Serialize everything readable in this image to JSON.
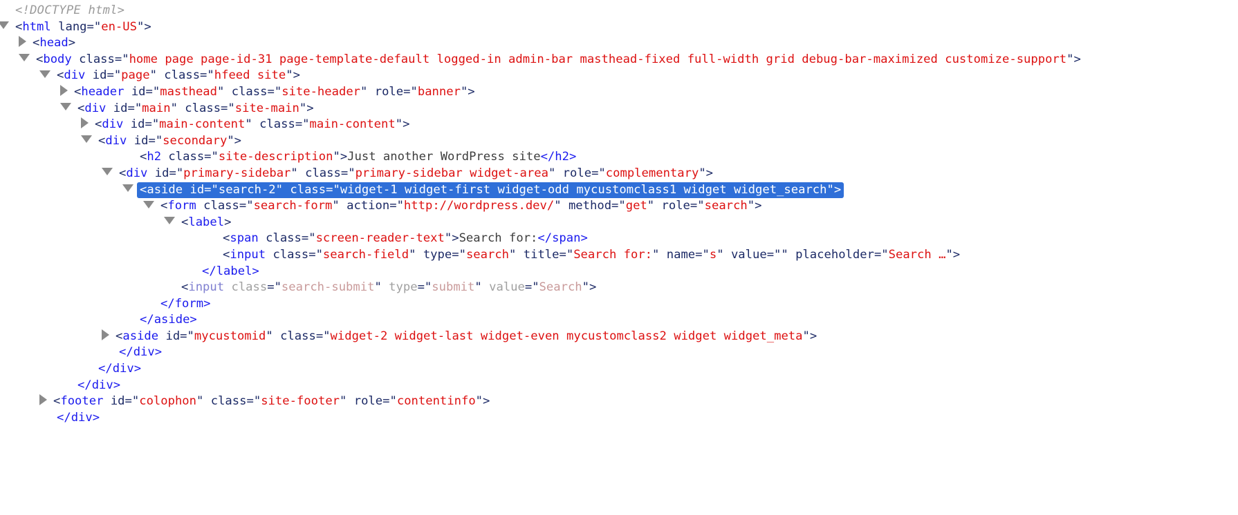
{
  "inspector": {
    "title": "DOM tree inspector",
    "selected_node_id": "search-2",
    "colors": {
      "tag": "#1a1aee",
      "attribute_name": "#1c2a66",
      "attribute_value": "#dd1111",
      "text_content": "#3d3d3d",
      "doctype": "#9a9a9a",
      "dimmed": "#a8a8a8",
      "selection_background": "#2f6fd8",
      "selection_text": "#ffffff",
      "twisty": "#8a8a8a",
      "background": "#ffffff"
    }
  },
  "rows": [
    {
      "depth": 1,
      "twisty": "none",
      "kind": "doctype",
      "text": "<!DOCTYPE html>"
    },
    {
      "depth": 0,
      "twisty": "open",
      "kind": "element",
      "open": "<",
      "tag": "html",
      "attrs": [
        {
          "name": "lang",
          "value": "en-US"
        }
      ],
      "close": ">"
    },
    {
      "depth": 2,
      "twisty": "closed",
      "kind": "element",
      "open": "<",
      "tag": "head",
      "attrs": [],
      "close": ">"
    },
    {
      "depth": 2,
      "twisty": "open",
      "kind": "element",
      "open": "<",
      "tag": "body",
      "attrs": [
        {
          "name": "class",
          "value": "home page page-id-31 page-template-default logged-in admin-bar masthead-fixed full-width grid debug-bar-maximized customize-support"
        }
      ],
      "close": ">"
    },
    {
      "depth": 4,
      "twisty": "open",
      "kind": "element",
      "open": "<",
      "tag": "div",
      "attrs": [
        {
          "name": "id",
          "value": "page"
        },
        {
          "name": "class",
          "value": "hfeed site"
        }
      ],
      "close": ">"
    },
    {
      "depth": 5,
      "twisty": "closed",
      "kind": "element",
      "open": "<",
      "tag": "header",
      "attrs": [
        {
          "name": "id",
          "value": "masthead"
        },
        {
          "name": "class",
          "value": "site-header"
        },
        {
          "name": "role",
          "value": "banner"
        }
      ],
      "close": ">"
    },
    {
      "depth": 5,
      "twisty": "open",
      "kind": "element",
      "open": "<",
      "tag": "div",
      "attrs": [
        {
          "name": "id",
          "value": "main"
        },
        {
          "name": "class",
          "value": "site-main"
        }
      ],
      "close": ">"
    },
    {
      "depth": 6,
      "twisty": "closed",
      "kind": "element",
      "open": "<",
      "tag": "div",
      "attrs": [
        {
          "name": "id",
          "value": "main-content"
        },
        {
          "name": "class",
          "value": "main-content"
        }
      ],
      "close": ">"
    },
    {
      "depth": 6,
      "twisty": "open",
      "kind": "element",
      "open": "<",
      "tag": "div",
      "attrs": [
        {
          "name": "id",
          "value": "secondary"
        }
      ],
      "close": ">"
    },
    {
      "depth": 8,
      "twisty": "none",
      "kind": "element-inline",
      "open": "<",
      "tag": "h2",
      "attrs": [
        {
          "name": "class",
          "value": "site-description"
        }
      ],
      "close": ">",
      "inner_text": "Just another WordPress site",
      "end_tag": "</h2>"
    },
    {
      "depth": 7,
      "twisty": "open",
      "kind": "element",
      "open": "<",
      "tag": "div",
      "attrs": [
        {
          "name": "id",
          "value": "primary-sidebar"
        },
        {
          "name": "class",
          "value": "primary-sidebar widget-area"
        },
        {
          "name": "role",
          "value": "complementary"
        }
      ],
      "close": ">"
    },
    {
      "depth": 8,
      "twisty": "open",
      "selected": true,
      "kind": "element",
      "open": "<",
      "tag": "aside",
      "attrs": [
        {
          "name": "id",
          "value": "search-2"
        },
        {
          "name": "class",
          "value": "widget-1 widget-first widget-odd mycustomclass1 widget widget_search"
        }
      ],
      "close": ">"
    },
    {
      "depth": 9,
      "twisty": "open",
      "kind": "element",
      "open": "<",
      "tag": "form",
      "attrs": [
        {
          "name": "class",
          "value": "search-form"
        },
        {
          "name": "action",
          "value": "http://wordpress.dev/"
        },
        {
          "name": "method",
          "value": "get"
        },
        {
          "name": "role",
          "value": "search"
        }
      ],
      "close": ">"
    },
    {
      "depth": 10,
      "twisty": "open",
      "kind": "element",
      "open": "<",
      "tag": "label",
      "attrs": [],
      "close": ">"
    },
    {
      "depth": 12,
      "twisty": "none",
      "kind": "element-inline",
      "open": "<",
      "tag": "span",
      "attrs": [
        {
          "name": "class",
          "value": "screen-reader-text"
        }
      ],
      "close": ">",
      "inner_text": "Search for:",
      "end_tag": "</span>"
    },
    {
      "depth": 12,
      "twisty": "none",
      "kind": "element",
      "open": "<",
      "tag": "input",
      "attrs": [
        {
          "name": "class",
          "value": "search-field"
        },
        {
          "name": "type",
          "value": "search"
        },
        {
          "name": "title",
          "value": "Search for:"
        },
        {
          "name": "name",
          "value": "s"
        },
        {
          "name": "value",
          "value": ""
        },
        {
          "name": "placeholder",
          "value": "Search …"
        }
      ],
      "close": ">"
    },
    {
      "depth": 11,
      "twisty": "none",
      "kind": "closing",
      "text": "</label>"
    },
    {
      "depth": 10,
      "twisty": "none",
      "dimmed": true,
      "kind": "element",
      "open": "<",
      "tag": "input",
      "attrs": [
        {
          "name": "class",
          "value": "search-submit"
        },
        {
          "name": "type",
          "value": "submit"
        },
        {
          "name": "value",
          "value": "Search"
        }
      ],
      "close": ">"
    },
    {
      "depth": 9,
      "twisty": "none",
      "kind": "closing",
      "text": "</form>"
    },
    {
      "depth": 8,
      "twisty": "none",
      "kind": "closing",
      "text": "</aside>"
    },
    {
      "depth": 7,
      "twisty": "closed",
      "kind": "element",
      "open": "<",
      "tag": "aside",
      "attrs": [
        {
          "name": "id",
          "value": "mycustomid"
        },
        {
          "name": "class",
          "value": "widget-2 widget-last widget-even mycustomclass2 widget widget_meta"
        }
      ],
      "close": ">"
    },
    {
      "depth": 7,
      "twisty": "none",
      "kind": "closing",
      "text": "</div>"
    },
    {
      "depth": 6,
      "twisty": "none",
      "kind": "closing",
      "text": "</div>"
    },
    {
      "depth": 5,
      "twisty": "none",
      "kind": "closing",
      "text": "</div>"
    },
    {
      "depth": 4,
      "twisty": "closed",
      "kind": "element",
      "open": "<",
      "tag": "footer",
      "attrs": [
        {
          "name": "id",
          "value": "colophon"
        },
        {
          "name": "class",
          "value": "site-footer"
        },
        {
          "name": "role",
          "value": "contentinfo"
        }
      ],
      "close": ">"
    },
    {
      "depth": 4,
      "twisty": "none",
      "kind": "closing",
      "text": "</div>"
    }
  ]
}
